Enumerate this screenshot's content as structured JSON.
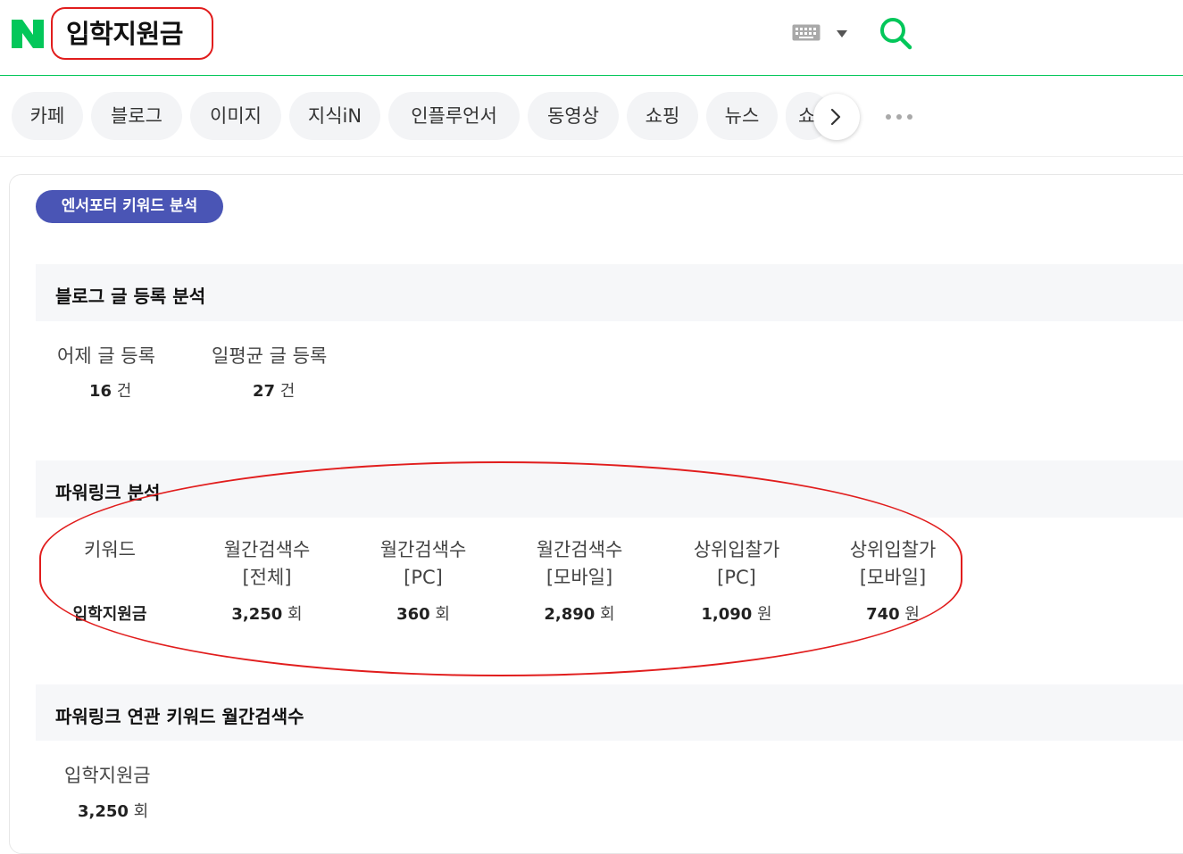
{
  "header": {
    "search_query": "입학지원금",
    "logo_icon": "naver-n-logo-icon",
    "brand_color": "#03c75a"
  },
  "tabs": [
    "카페",
    "블로그",
    "이미지",
    "지식iN",
    "인플루언서",
    "동영상",
    "쇼핑",
    "뉴스",
    "쇼"
  ],
  "badge": "엔서포터 키워드 분석",
  "blog_analysis": {
    "title": "블로그 글 등록 분석",
    "stats": [
      {
        "label": "어제 글 등록",
        "value": "16",
        "unit": "건"
      },
      {
        "label": "일평균 글 등록",
        "value": "27",
        "unit": "건"
      }
    ]
  },
  "powerlink": {
    "title": "파워링크 분석",
    "columns": [
      [
        "키워드"
      ],
      [
        "월간검색수",
        "[전체]"
      ],
      [
        "월간검색수",
        "[PC]"
      ],
      [
        "월간검색수",
        "[모바일]"
      ],
      [
        "상위입찰가",
        "[PC]"
      ],
      [
        "상위입찰가",
        "[모바일]"
      ]
    ],
    "row": [
      {
        "value": "입학지원금",
        "unit": ""
      },
      {
        "value": "3,250",
        "unit": "회"
      },
      {
        "value": "360",
        "unit": "회"
      },
      {
        "value": "2,890",
        "unit": "회"
      },
      {
        "value": "1,090",
        "unit": "원"
      },
      {
        "value": "740",
        "unit": "원"
      }
    ]
  },
  "related": {
    "title": "파워링크 연관 키워드 월간검색수",
    "items": [
      {
        "keyword": "입학지원금",
        "value": "3,250",
        "unit": "회"
      }
    ]
  }
}
